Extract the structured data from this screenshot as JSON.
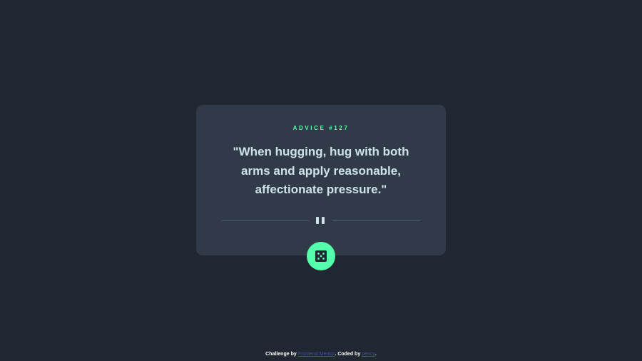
{
  "card": {
    "advice_label": "ADVICE #127",
    "quote": "\"When hugging, hug with both arms and apply reasonable, affectionate pressure.\""
  },
  "controls": {
    "dice_icon": "dice-icon",
    "divider_icon": "pause-icon"
  },
  "attribution": {
    "prefix": "Challenge by ",
    "link1": "Frontend Mentor",
    "middle": ". Coded by ",
    "link2": "pericy",
    "suffix": "."
  },
  "colors": {
    "background": "#202632",
    "card": "#313a48",
    "accent": "#53ffaa",
    "text": "#cee3e9",
    "divider": "#4f5d74",
    "link": "#3e52a3"
  }
}
